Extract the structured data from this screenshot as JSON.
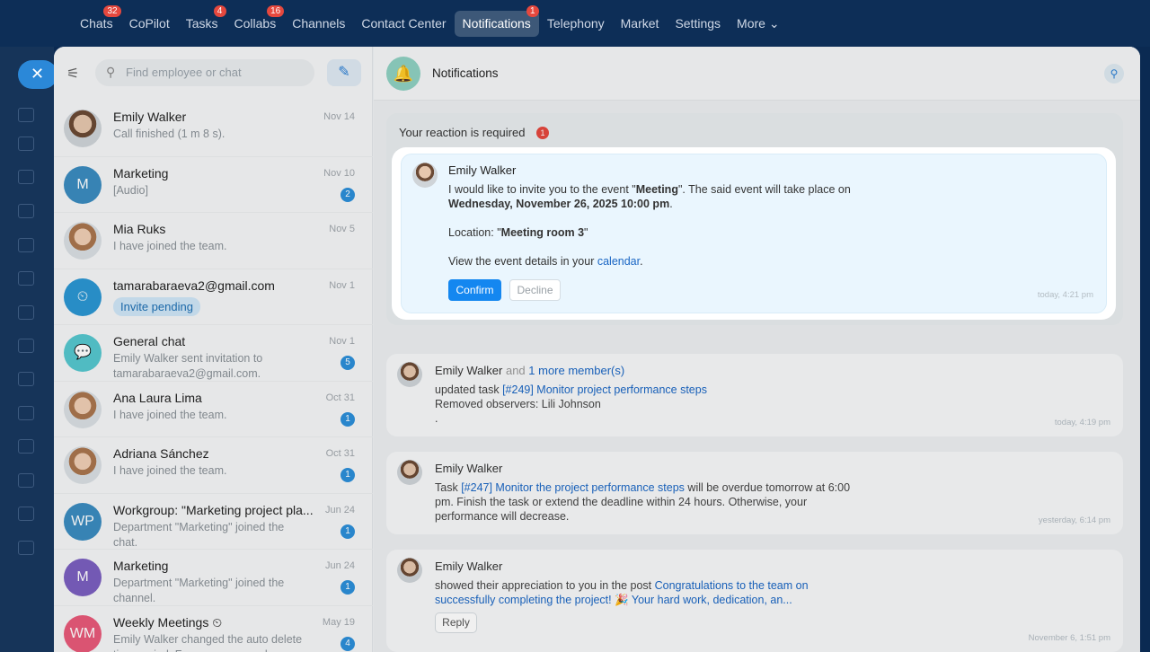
{
  "topnav": [
    {
      "label": "Chats",
      "badge": "32"
    },
    {
      "label": "CoPilot",
      "badge": ""
    },
    {
      "label": "Tasks",
      "badge": "4"
    },
    {
      "label": "Collabs",
      "badge": "16"
    },
    {
      "label": "Channels",
      "badge": ""
    },
    {
      "label": "Contact Center",
      "badge": ""
    },
    {
      "label": "Notifications",
      "badge": "1"
    },
    {
      "label": "Telephony",
      "badge": ""
    },
    {
      "label": "Market",
      "badge": ""
    },
    {
      "label": "Settings",
      "badge": ""
    },
    {
      "label": "More ⌄",
      "badge": ""
    }
  ],
  "search": {
    "placeholder": "Find employee or chat"
  },
  "chats": [
    {
      "name": "Emily Walker",
      "date": "Nov 14",
      "preview": "Call finished (1 m 8 s).",
      "count": "",
      "avatar": "photo",
      "initials": ""
    },
    {
      "name": "Marketing",
      "date": "Nov 10",
      "preview": "[Audio]",
      "count": "2",
      "avatar": "#3b8cc0",
      "initials": "M"
    },
    {
      "name": "Mia Ruks",
      "date": "Nov 5",
      "preview": "I have joined the team.",
      "count": "",
      "avatar": "photo2",
      "initials": ""
    },
    {
      "name": "tamarabaraeva2@gmail.com",
      "date": "Nov 1",
      "preview": "",
      "pill": "Invite pending",
      "count": "",
      "avatar": "#2b96d3",
      "initials": "⏲"
    },
    {
      "name": "General chat",
      "date": "Nov 1",
      "preview": "Emily Walker sent invitation to tamarabaraeva2@gmail.com.",
      "count": "5",
      "avatar": "#55c7cf",
      "initials": "💬"
    },
    {
      "name": "Ana Laura Lima",
      "date": "Oct 31",
      "preview": "I have joined the team.",
      "count": "1",
      "avatar": "photo2",
      "initials": ""
    },
    {
      "name": "Adriana Sánchez",
      "date": "Oct 31",
      "preview": "I have joined the team.",
      "count": "1",
      "avatar": "photo2",
      "initials": ""
    },
    {
      "name": "Workgroup: \"Marketing project pla...",
      "date": "Jun 24",
      "preview": "Department \"Marketing\" joined the chat.",
      "count": "1",
      "avatar": "#3b8cc0",
      "initials": "WP"
    },
    {
      "name": "Marketing",
      "date": "Jun 24",
      "preview": "Department \"Marketing\" joined the channel.",
      "count": "1",
      "avatar": "#7b5fc0",
      "initials": "M"
    },
    {
      "name": "Weekly Meetings ⏲",
      "date": "May 19",
      "preview": "Emily Walker changed the auto delete time period. From now on, each new",
      "count": "4",
      "avatar": "#e85a7a",
      "initials": "WM"
    }
  ],
  "header": {
    "title": "Notifications"
  },
  "section": {
    "title": "Your reaction is required",
    "badge": "1"
  },
  "invite": {
    "name": "Emily Walker",
    "line1": "I would like to invite you to the event \"",
    "event": "Meeting",
    "line1b": "\". The said event will take place on",
    "when": "Wednesday, November 26, 2025 10:00 pm",
    "location_label": "Location: \"",
    "location": "Meeting room 3",
    "details": "View the event details in your ",
    "calendar": "calendar",
    "confirm": "Confirm",
    "decline": "Decline",
    "time": "today, 4:21 pm"
  },
  "notifications": [
    {
      "name": "Emily Walker",
      "and": " and ",
      "more": "1 more member(s)",
      "pre": "updated task ",
      "link": "[#249] Monitor project performance steps",
      "post": "",
      "extra": "Removed observers: Lili Johnson",
      "extra2": ".",
      "time": "today, 4:19 pm"
    },
    {
      "name": "Emily Walker",
      "pre": "Task ",
      "link": "[#247] Monitor the project performance steps",
      "post": " will be overdue tomorrow at 6:00 pm. Finish the task or extend the deadline within 24 hours. Otherwise, your performance will decrease.",
      "time": "yesterday, 6:14 pm"
    },
    {
      "name": "Emily Walker",
      "pre": "showed their appreciation to you in the post ",
      "link": "Congratulations to the team on successfully completing the project! 🎉 Your hard work, dedication, an...",
      "post": "",
      "reply": "Reply",
      "time": "November 6, 1:51 pm"
    }
  ]
}
